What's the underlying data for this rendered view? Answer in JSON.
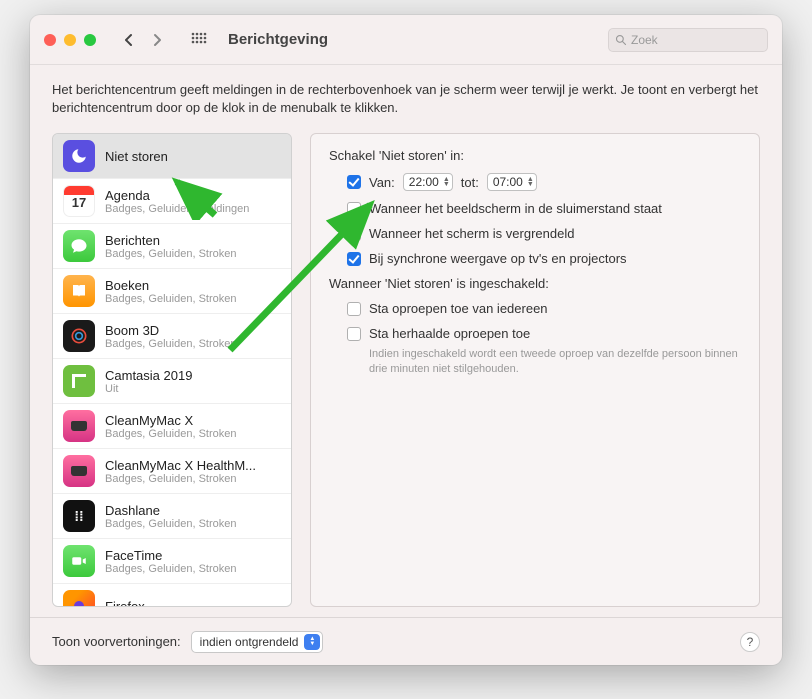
{
  "window": {
    "title": "Berichtgeving"
  },
  "search": {
    "placeholder": "Zoek"
  },
  "description": "Het berichtencentrum geeft meldingen in de rechterbovenhoek van je scherm weer terwijl je werkt. Je toont en verbergt het berichtencentrum door op de klok in de menubalk te klikken.",
  "sidebar": {
    "items": [
      {
        "name": "Niet storen",
        "sub": ""
      },
      {
        "name": "Agenda",
        "sub": "Badges, Geluiden, Meldingen"
      },
      {
        "name": "Berichten",
        "sub": "Badges, Geluiden, Stroken"
      },
      {
        "name": "Boeken",
        "sub": "Badges, Geluiden, Stroken"
      },
      {
        "name": "Boom 3D",
        "sub": "Badges, Geluiden, Stroken"
      },
      {
        "name": "Camtasia 2019",
        "sub": "Uit"
      },
      {
        "name": "CleanMyMac X",
        "sub": "Badges, Geluiden, Stroken"
      },
      {
        "name": "CleanMyMac X HealthM...",
        "sub": "Badges, Geluiden, Stroken"
      },
      {
        "name": "Dashlane",
        "sub": "Badges, Geluiden, Stroken"
      },
      {
        "name": "FaceTime",
        "sub": "Badges, Geluiden, Stroken"
      },
      {
        "name": "Firefox",
        "sub": ""
      }
    ]
  },
  "detail": {
    "enableLabel": "Schakel 'Niet storen' in:",
    "fromLabel": "Van:",
    "fromTime": "22:00",
    "toLabel": "tot:",
    "toTime": "07:00",
    "whenSleep": "Wanneer het beeldscherm in de sluimerstand staat",
    "whenLocked": "Wanneer het scherm is vergrendeld",
    "whenMirroring": "Bij synchrone weergave op tv's en projectors",
    "whenOnLabel": "Wanneer 'Niet storen' is ingeschakeld:",
    "allowAll": "Sta oproepen toe van iedereen",
    "allowRepeat": "Sta herhaalde oproepen toe",
    "hint": "Indien ingeschakeld wordt een tweede oproep van dezelfde persoon binnen drie minuten niet stilgehouden."
  },
  "footer": {
    "label": "Toon voorvertoningen:",
    "selected": "indien ontgrendeld"
  },
  "icons": {
    "calendarDay": "17"
  }
}
